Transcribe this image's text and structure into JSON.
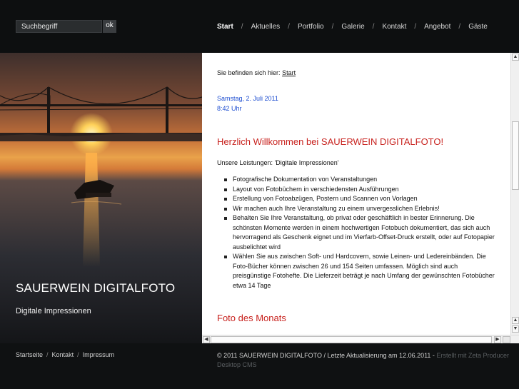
{
  "search": {
    "placeholder": "Suchbegriff",
    "button_label": "ok"
  },
  "nav": {
    "items": [
      {
        "label": "Start",
        "active": true
      },
      {
        "label": "Aktuelles"
      },
      {
        "label": "Portfolio"
      },
      {
        "label": "Galerie"
      },
      {
        "label": "Kontakt"
      },
      {
        "label": "Angebot"
      },
      {
        "label": "Gäste"
      }
    ],
    "separator": "/"
  },
  "hero": {
    "title": "SAUERWEIN DIGITALFOTO",
    "subtitle": "Digitale Impressionen"
  },
  "main": {
    "breadcrumb_prefix": "Sie befinden sich hier:",
    "breadcrumb_link": "Start",
    "date_line": "Samstag, 2. Juli 2011",
    "time_line": "8:42 Uhr",
    "heading": "Herzlich Willkommen bei SAUERWEIN DIGITALFOTO!",
    "intro": "Unsere Leistungen: 'Digitale Impressionen'",
    "services": [
      "Fotografische Dokumentation von Veranstaltungen",
      "Layout von Fotobüchern in verschiedensten Ausführungen",
      "Erstellung von Fotoabzügen, Postern und Scannen von Vorlagen",
      "Wir machen auch Ihre Veranstaltung zu einem unvergesslichen Erlebnis!",
      "Behalten Sie Ihre Veranstaltung, ob privat oder geschäftlich in bester Erinnerung. Die schönsten Momente werden in einem hochwertigen Fotobuch dokumentiert, das sich auch hervorragend als Geschenk eignet und im Vierfarb-Offset-Druck erstellt, oder auf Fotopapier ausbelichtet wird",
      "Wählen Sie aus zwischen Soft- und Hardcovern, sowie Leinen- und Ledereinbänden. Die Foto-Bücher können zwischen 26 und 154 Seiten umfassen. Möglich sind auch preisgünstige Fotohefte. Die Lieferzeit beträgt je nach Umfang der gewünschten Fotobücher etwa 14 Tage"
    ],
    "heading2": "Foto des Monats"
  },
  "footer": {
    "links": [
      "Startseite",
      "Kontakt",
      "Impressum"
    ],
    "copyright": "© 2011 SAUERWEIN DIGITALFOTO / Letzte Aktualisierung am 12.06.2011 -",
    "cms_note": "Erstellt mit Zeta Producer Desktop CMS"
  },
  "colors": {
    "background": "#0f1112",
    "accent_red": "#c8221e",
    "date_blue": "#1f4fd1"
  }
}
